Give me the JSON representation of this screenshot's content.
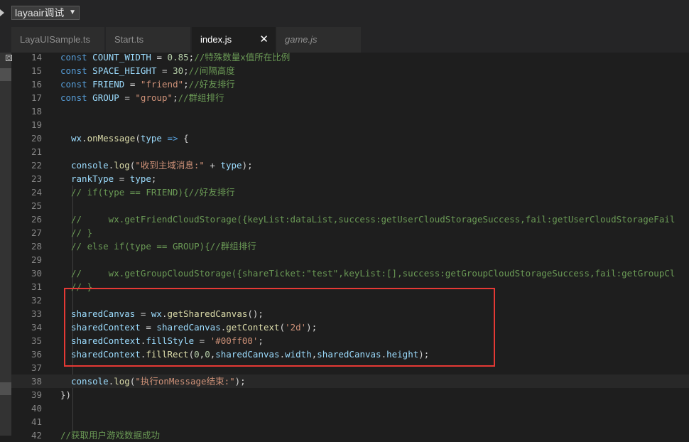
{
  "debug": {
    "config_label": "layaair调试",
    "dropdown_arrow": "▼"
  },
  "tabs": [
    {
      "label": "LayaUISample.ts"
    },
    {
      "label": "Start.ts"
    },
    {
      "label": "index.js",
      "close": "✕"
    },
    {
      "label": "game.js"
    }
  ],
  "sidebar": {
    "collapse_icon": "⊟"
  },
  "code": {
    "line_numbers": [
      "14",
      "15",
      "16",
      "17",
      "18",
      "19",
      "20",
      "21",
      "22",
      "23",
      "24",
      "25",
      "26",
      "27",
      "28",
      "29",
      "30",
      "31",
      "32",
      "33",
      "34",
      "35",
      "36",
      "37",
      "38",
      "39",
      "40",
      "41",
      "42"
    ],
    "l14": {
      "kw": "const",
      "name": " COUNT_WIDTH ",
      "op": "= ",
      "val": "0.85",
      "semi": ";",
      "cm": "//特殊数量x值所在比例"
    },
    "l15": {
      "kw": "const",
      "name": " SPACE_HEIGHT ",
      "op": "= ",
      "val": "30",
      "semi": ";",
      "cm": "//间隔高度"
    },
    "l16": {
      "kw": "const",
      "name": " FRIEND ",
      "op": "= ",
      "val": "\"friend\"",
      "semi": ";",
      "cm": "//好友排行"
    },
    "l17": {
      "kw": "const",
      "name": " GROUP ",
      "op": "= ",
      "val": "\"group\"",
      "semi": ";",
      "cm": "//群组排行"
    },
    "l20": {
      "obj": "wx",
      "dot": ".",
      "fn": "onMessage",
      "p1": "(",
      "param": "type",
      "arrow": " => ",
      "brace": "{"
    },
    "l22": {
      "obj": "console",
      "dot": ".",
      "fn": "log",
      "p1": "(",
      "str": "\"收到主域消息:\"",
      "plus": " + ",
      "arg": "type",
      "end": ");"
    },
    "l23": {
      "var": "rankType",
      "eq": " = ",
      "val": "type",
      "end": ";"
    },
    "l24": "// if(type == FRIEND){//好友排行",
    "l26": "//     wx.getFriendCloudStorage({keyList:dataList,success:getUserCloudStorageSuccess,fail:getUserCloudStorageFail",
    "l27": "// }",
    "l28": "// else if(type == GROUP){//群组排行",
    "l30": "//     wx.getGroupCloudStorage({shareTicket:\"test\",keyList:[],success:getGroupCloudStorageSuccess,fail:getGroupCl",
    "l31": "// }",
    "l33": {
      "var": "sharedCanvas",
      "eq": " = ",
      "obj": "wx",
      "dot": ".",
      "fn": "getSharedCanvas",
      "end": "();"
    },
    "l34": {
      "var": "sharedContext",
      "eq": " = ",
      "obj": "sharedCanvas",
      "dot": ".",
      "fn": "getContext",
      "p1": "(",
      "str": "'2d'",
      "end": ");"
    },
    "l35": {
      "obj": "sharedContext",
      "dot": ".",
      "prop": "fillStyle",
      "eq": " = ",
      "str": "'#00ff00'",
      "end": ";"
    },
    "l36": {
      "obj": "sharedContext",
      "dot": ".",
      "fn": "fillRect",
      "p1": "(",
      "n1": "0",
      "c1": ",",
      "n2": "0",
      "c2": ",",
      "a3o": "sharedCanvas",
      "a3d": ".",
      "a3p": "width",
      "c3": ",",
      "a4o": "sharedCanvas",
      "a4d": ".",
      "a4p": "height",
      "end": ");"
    },
    "l38": {
      "obj": "console",
      "dot": ".",
      "fn": "log",
      "p1": "(",
      "str": "\"执行onMessage结束:\"",
      "end": ");"
    },
    "l39": "})",
    "l42": "//获取用户游戏数据成功"
  },
  "colors": {
    "highlight_box": "#e53935",
    "background": "#1e1e1e"
  }
}
